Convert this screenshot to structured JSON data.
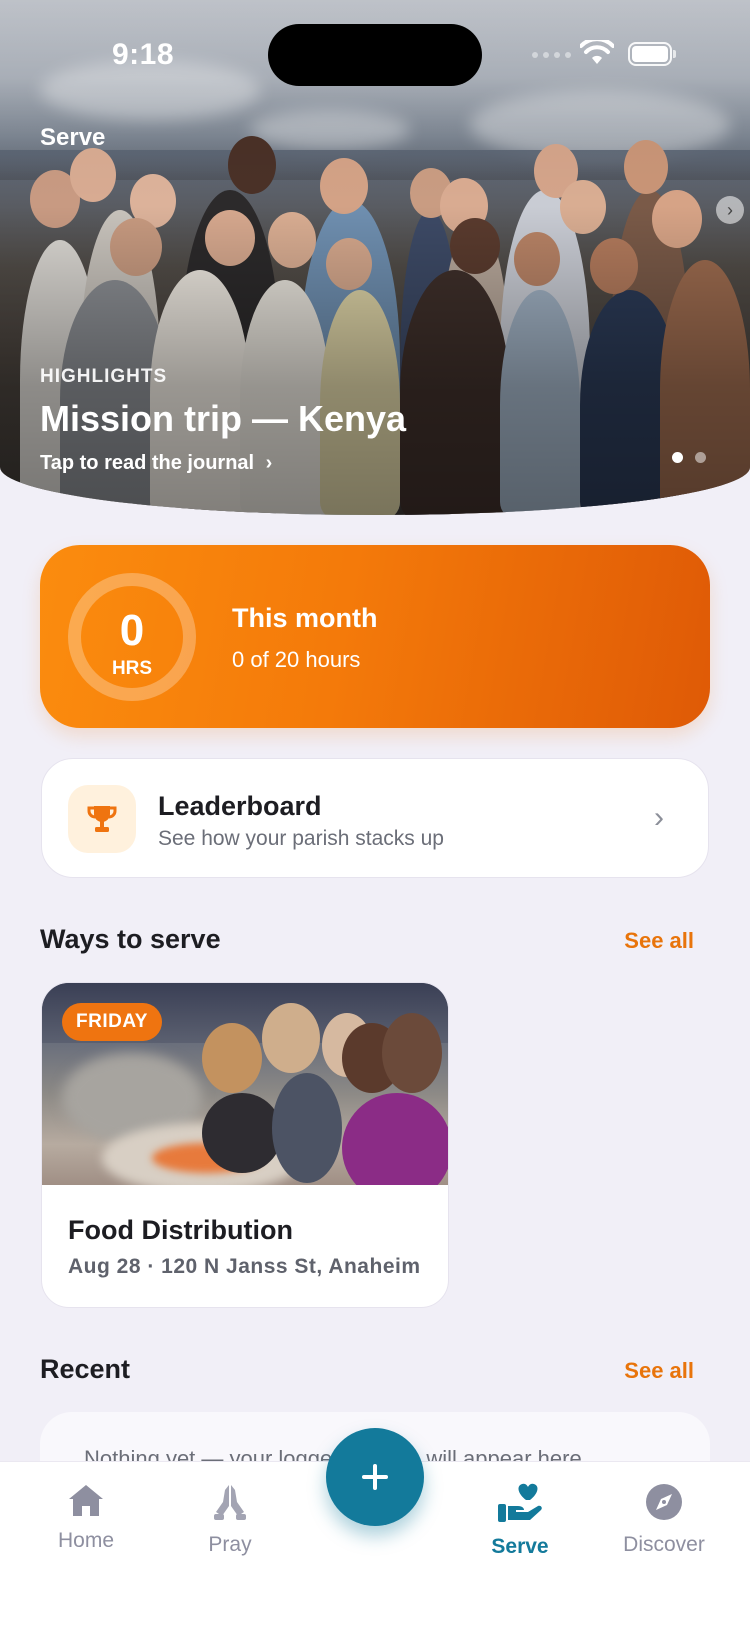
{
  "status_bar": {
    "time": "9:18"
  },
  "hero": {
    "section_title": "Serve",
    "eyebrow": "HIGHLIGHTS",
    "title": "Mission trip — Kenya",
    "link": "Tap to read the journal",
    "link_chevron": "›",
    "next_icon": "chevron-right-icon",
    "pages": 2,
    "active_page": 1
  },
  "hours": {
    "value": "0",
    "unit": "HRS",
    "title": "This month",
    "subtitle": "0 of 20 hours",
    "progress": 0,
    "goal": 20,
    "accent": "#f47a0a"
  },
  "leaderboard": {
    "icon": "trophy-icon",
    "title": "Leaderboard",
    "subtitle": "See how your parish stacks up",
    "chevron": "›"
  },
  "ways_to_serve": {
    "title": "Ways to serve",
    "see_all": "See all",
    "cards": [
      {
        "badge": "FRIDAY",
        "title": "Food Distribution",
        "meta": "Aug 28 · 120 N Janss St, Anaheim"
      }
    ]
  },
  "recent": {
    "title": "Recent",
    "see_all": "See all",
    "empty_text": "Nothing yet — your logged service will appear here."
  },
  "tabbar": {
    "tabs": [
      {
        "label": "Home",
        "icon": "home-icon"
      },
      {
        "label": "Pray",
        "icon": "praying-hands-icon"
      },
      {
        "label": "Serve",
        "icon": "serve-hand-heart-icon",
        "active": true
      },
      {
        "label": "Discover",
        "icon": "compass-icon"
      }
    ],
    "fab_icon": "plus-icon",
    "active_color": "#137a9b"
  }
}
